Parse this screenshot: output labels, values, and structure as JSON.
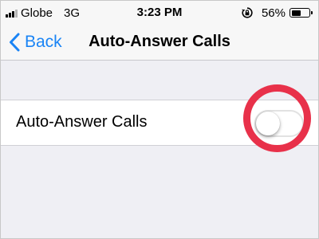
{
  "status_bar": {
    "carrier": "Globe",
    "network": "3G",
    "time": "3:23 PM",
    "battery_percent": "56%",
    "battery_level": 0.56,
    "signal_bars_filled": 3,
    "signal_bars_total": 4,
    "icons": [
      "signal-icon",
      "rotation-lock-icon",
      "battery-icon"
    ]
  },
  "nav": {
    "back_label": "Back",
    "title": "Auto-Answer Calls",
    "accent_color": "#1a84f5",
    "back_icon": "chevron-left-icon"
  },
  "settings": {
    "auto_answer": {
      "label": "Auto-Answer Calls",
      "enabled": false
    }
  },
  "colors": {
    "highlight": "#e8314a",
    "background": "#efeff4"
  }
}
